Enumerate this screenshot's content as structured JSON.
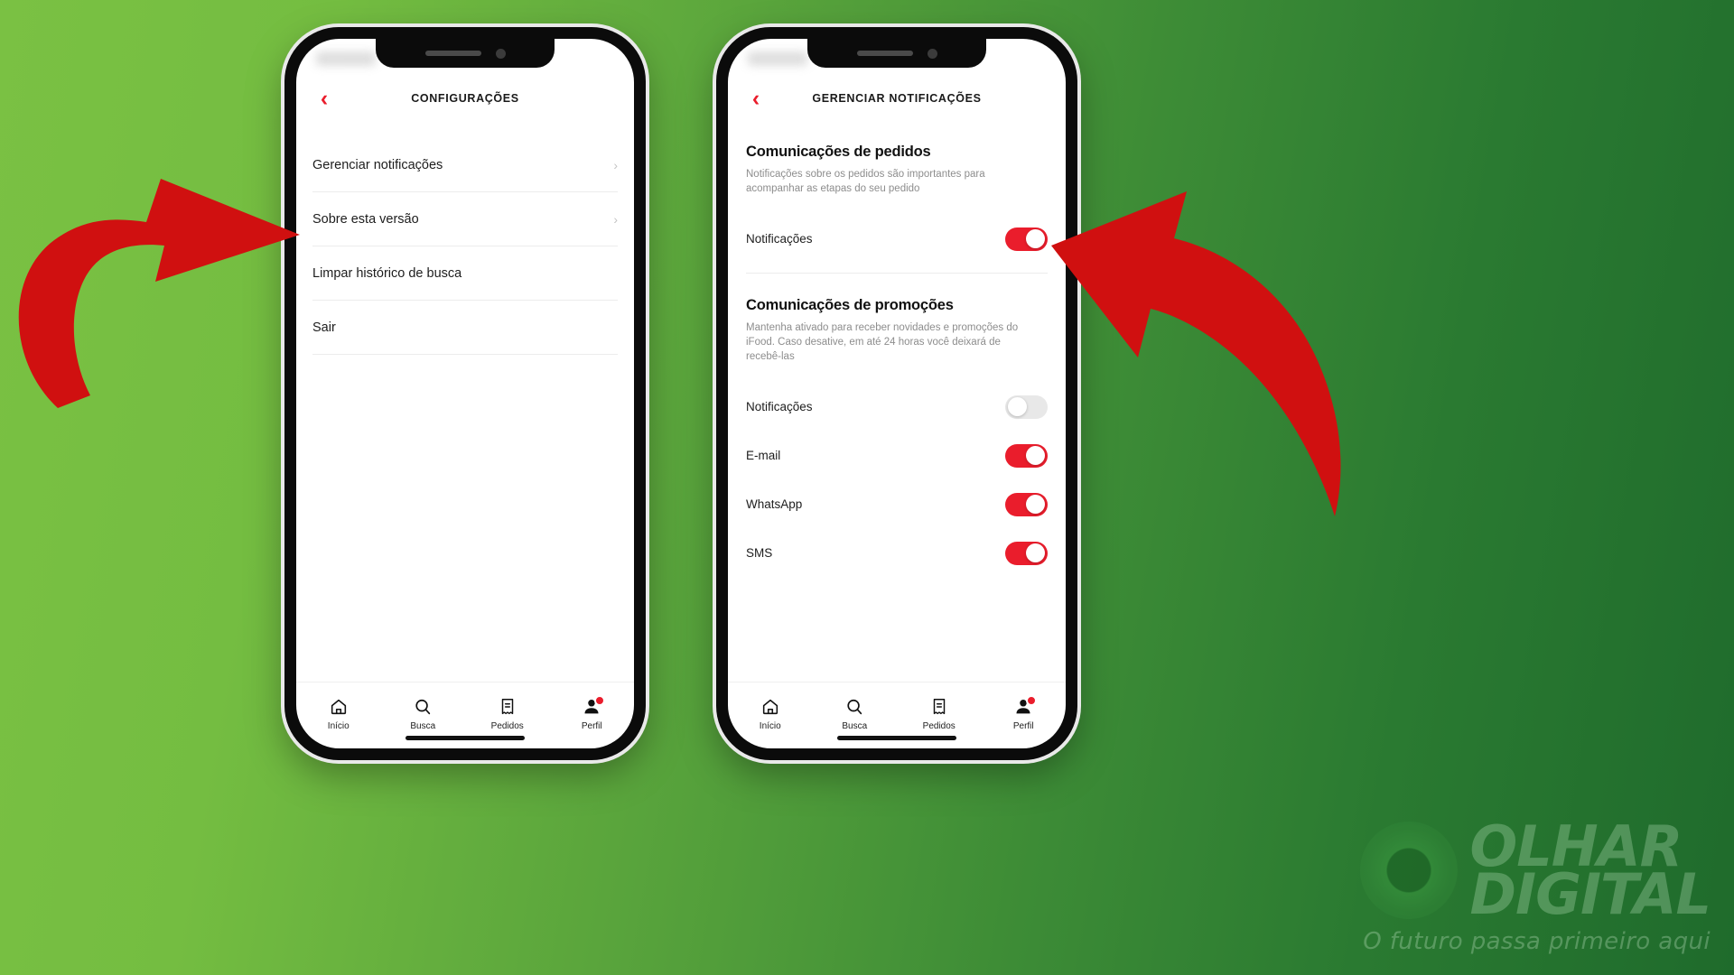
{
  "background": {
    "gradient_from": "#7ac143",
    "gradient_to": "#1f6b2c"
  },
  "brand": {
    "accent": "#ea1d2c",
    "toggle_off": "#e8e8e8"
  },
  "phones": [
    {
      "id": "settings",
      "header": {
        "title": "CONFIGURAÇÕES",
        "back_label": "‹"
      },
      "rows": [
        {
          "label": "Gerenciar notificações",
          "chevron": "›",
          "has_chevron": true
        },
        {
          "label": "Sobre esta versão",
          "chevron": "›",
          "has_chevron": true
        },
        {
          "label": "Limpar histórico de busca",
          "chevron": "",
          "has_chevron": false
        },
        {
          "label": "Sair",
          "chevron": "",
          "has_chevron": false
        }
      ]
    },
    {
      "id": "manage-notifications",
      "header": {
        "title": "GERENCIAR NOTIFICAÇÕES",
        "back_label": "‹"
      },
      "sections": [
        {
          "title": "Comunicações de pedidos",
          "description": "Notificações sobre os pedidos são importantes para acompanhar as etapas do seu pedido",
          "toggles": [
            {
              "label": "Notificações",
              "state": "on"
            }
          ]
        },
        {
          "title": "Comunicações de promoções",
          "description": "Mantenha ativado para receber novidades e promoções do iFood. Caso desative, em até 24 horas você deixará de recebê-las",
          "toggles": [
            {
              "label": "Notificações",
              "state": "off"
            },
            {
              "label": "E-mail",
              "state": "on"
            },
            {
              "label": "WhatsApp",
              "state": "on"
            },
            {
              "label": "SMS",
              "state": "on"
            }
          ]
        }
      ]
    }
  ],
  "tabbar": {
    "tabs": [
      {
        "label": "Início",
        "icon": "home-icon",
        "badge": false
      },
      {
        "label": "Busca",
        "icon": "search-icon",
        "badge": false
      },
      {
        "label": "Pedidos",
        "icon": "receipt-icon",
        "badge": false
      },
      {
        "label": "Perfil",
        "icon": "profile-icon",
        "badge": true
      }
    ]
  },
  "annotations": {
    "arrows": [
      {
        "name": "arrow-to-gerenciar-notificacoes",
        "color": "#d01010"
      },
      {
        "name": "arrow-to-notificacoes-toggle",
        "color": "#d01010"
      }
    ]
  },
  "watermark": {
    "line1": "OLHAR",
    "line2": "DIGITAL",
    "tagline": "O futuro passa primeiro aqui"
  }
}
